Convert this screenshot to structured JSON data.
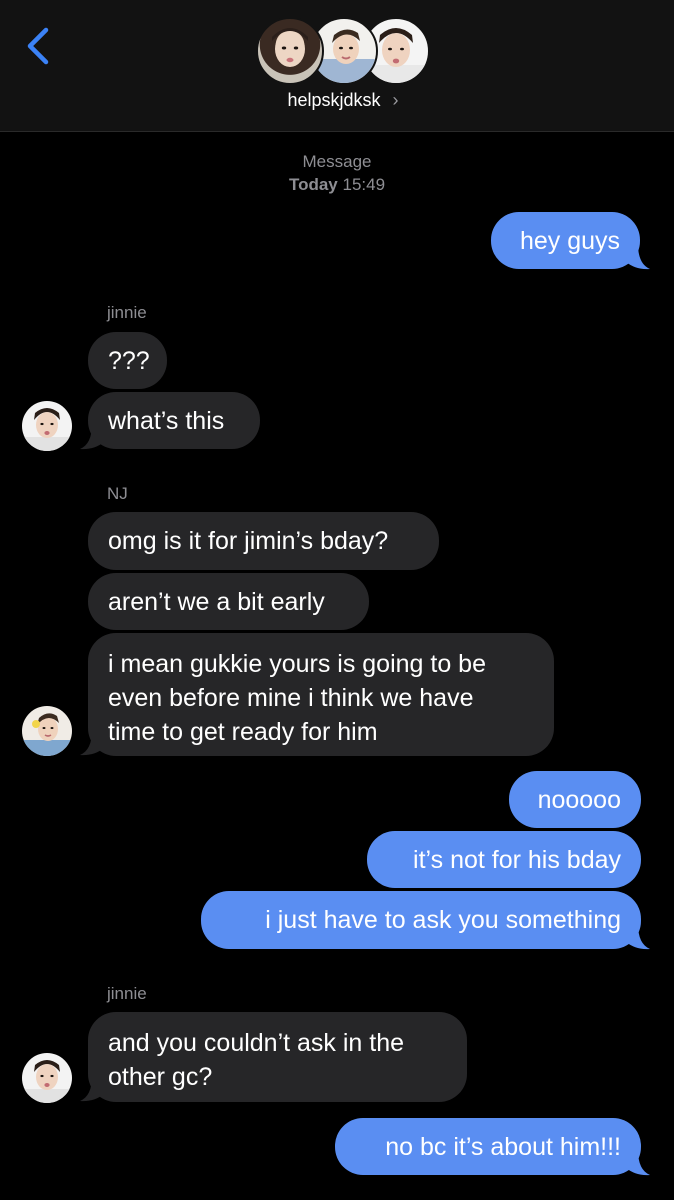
{
  "header": {
    "group_name": "helpskjdksk",
    "chevron": "›"
  },
  "timestamp": {
    "label": "Message",
    "day": "Today",
    "time": "15:49"
  },
  "colors": {
    "outgoing_bubble": "#5a8ef2",
    "incoming_bubble": "#262628",
    "back_arrow": "#3b82f6",
    "background": "#000000"
  },
  "messages": [
    {
      "from": "me",
      "text": "hey guys"
    },
    {
      "sender_label": "jinnie"
    },
    {
      "from": "jinnie",
      "text": "???"
    },
    {
      "from": "jinnie",
      "text": "what’s this"
    },
    {
      "sender_label": "NJ"
    },
    {
      "from": "NJ",
      "text": "omg is it for jimin’s bday?"
    },
    {
      "from": "NJ",
      "text": "aren’t we a bit early"
    },
    {
      "from": "NJ",
      "lines": [
        "i mean gukkie yours is going to be",
        "even before mine i think we have",
        "time to get ready for him"
      ]
    },
    {
      "from": "me",
      "text": "nooooo"
    },
    {
      "from": "me",
      "text": "it’s not for his bday"
    },
    {
      "from": "me",
      "text": "i just have to ask you something"
    },
    {
      "sender_label": "jinnie"
    },
    {
      "from": "jinnie",
      "lines": [
        "and you couldn’t ask in the",
        "other gc?"
      ]
    },
    {
      "from": "me",
      "text": "no bc it’s about him!!!"
    }
  ],
  "icons": {
    "back": "chevron-left-icon",
    "avatars": [
      "avatar-member-1",
      "avatar-member-2",
      "avatar-member-3"
    ]
  }
}
